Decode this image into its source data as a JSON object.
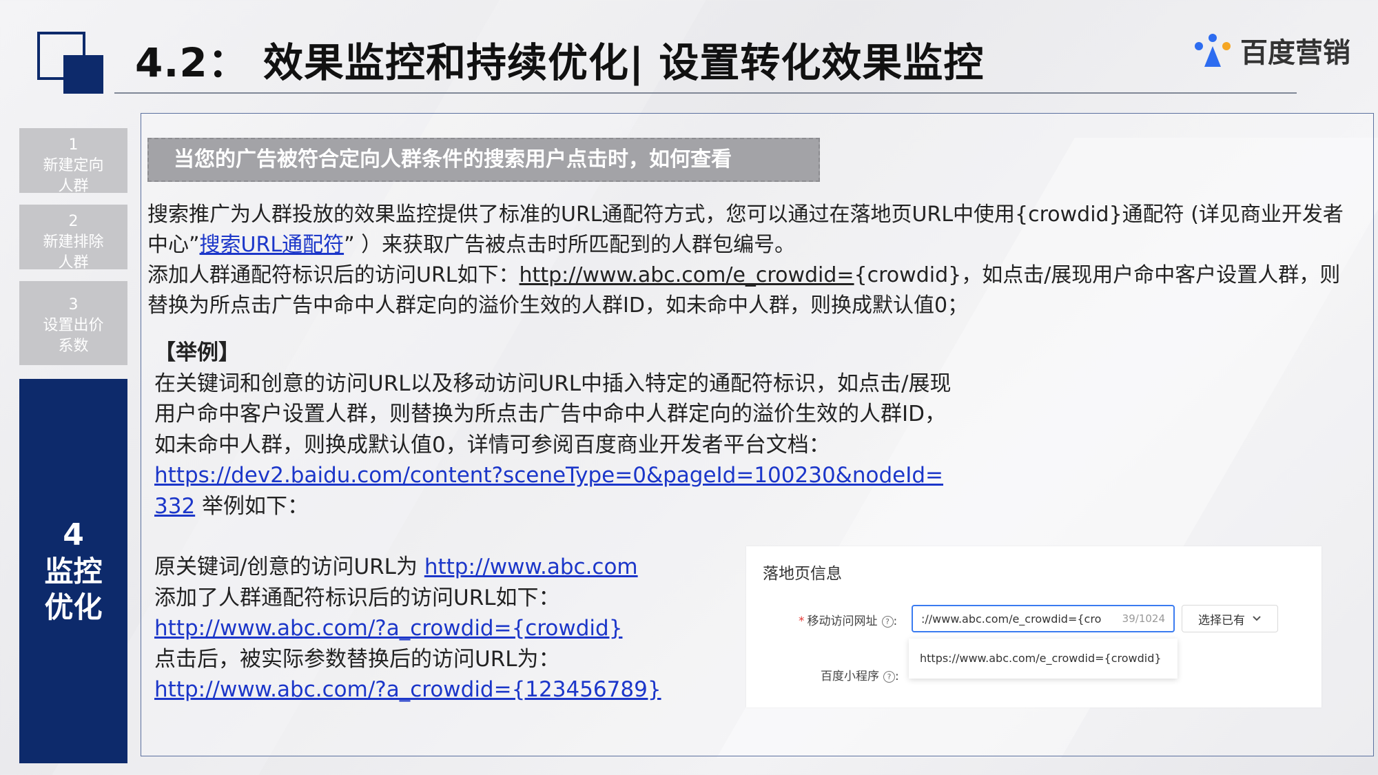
{
  "header": {
    "title": "4.2： 效果监控和持续优化| 设置转化效果监控",
    "brand": "百度营销"
  },
  "sidebar": {
    "items": [
      {
        "num": "1",
        "line1": "新建定向",
        "line2": "人群"
      },
      {
        "num": "2",
        "line1": "新建排除",
        "line2": "人群"
      },
      {
        "num": "3",
        "line1": "设置出价",
        "line2": "系数"
      }
    ],
    "active": {
      "num": "4",
      "line1": "监控",
      "line2": "优化"
    }
  },
  "main": {
    "banner": "当您的广告被符合定向人群条件的搜索用户点击时，如何查看",
    "p1_a": "搜索推广为人群投放的效果监控提供了标准的URL通配符方式，您可以通过在落地页URL中使用{crowdid}通配符 (详见商业开发者中心”",
    "p1_link": "搜索URL通配符",
    "p1_b": "” ）来获取广告被点击时所匹配到的人群包编号。",
    "p2_a": "添加人群通配符标识后的访问URL如下：",
    "p2_link": "http://www.abc.com/e_crowdid=",
    "p2_b": "{crowdid}，如点击/展现用户命中客户设置人群，则替换为所点击广告中命中人群定向的溢价生效的人群ID，如未命中人群，则换成默认值0；",
    "example": {
      "heading": "【举例】",
      "body": "在关键词和创意的访问URL以及移动访问URL中插入特定的通配符标识，如点击/展现用户命中客户设置人群，则替换为所点击广告中命中人群定向的溢价生效的人群ID，如未命中人群，则换成默认值0，详情可参阅百度商业开发者平台文档：",
      "doc_link": "https://dev2.baidu.com/content?sceneType=0&pageId=100230&nodeId=332",
      "after_link": " 举例如下：",
      "orig_label": "原关键词/创意的访问URL为 ",
      "orig_link": "http://www.abc.com",
      "added_label": "添加了人群通配符标识后的访问URL如下：",
      "added_link": "http://www.abc.com/?a_crowdid={crowdid}",
      "clicked_label": "点击后，被实际参数替换后的访问URL为：",
      "clicked_link": "http://www.abc.com/?a_crowdid={123456789}"
    },
    "panel": {
      "title": "落地页信息",
      "mobile_label": "移动访问网址",
      "mobile_value": "://www.abc.com/e_crowdid={cro",
      "count": "39/1024",
      "select_label": "选择已有",
      "miniprogram_label": "百度小程序",
      "suggestion": "https://www.abc.com/e_crowdid={crowdid}"
    }
  },
  "colors": {
    "navy": "#0d2a6b",
    "link": "#1b36c9",
    "nav_gray": "#c6c6c9"
  },
  "icons": [
    "help-circle-icon",
    "chevron-down-icon",
    "brand-logo-icon"
  ]
}
